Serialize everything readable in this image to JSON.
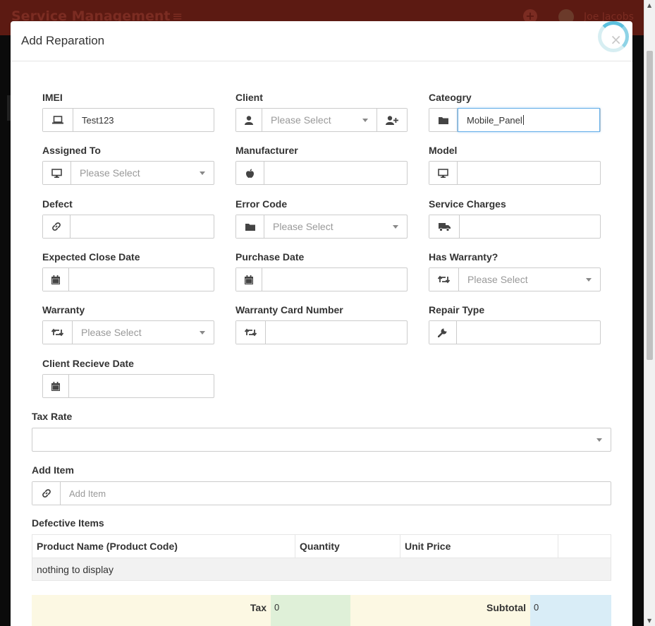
{
  "app": {
    "title": "Service Management",
    "menu_icon": "hamburger-icon",
    "add_icon": "plus-circle-icon",
    "user_name": "Joe Jacobs"
  },
  "modal": {
    "title": "Add Reparation",
    "close": "×"
  },
  "fields": {
    "imei": {
      "label": "IMEI",
      "value": "Test123",
      "icon": "laptop-icon"
    },
    "client": {
      "label": "Client",
      "placeholder": "Please Select",
      "icon": "user-icon",
      "action_icon": "user-plus-icon"
    },
    "category": {
      "label": "Cateogry",
      "value": "Mobile_Panel",
      "icon": "folder-icon"
    },
    "assigned_to": {
      "label": "Assigned To",
      "placeholder": "Please Select",
      "icon": "desktop-icon"
    },
    "manufacturer": {
      "label": "Manufacturer",
      "value": "",
      "icon": "apple-icon"
    },
    "model": {
      "label": "Model",
      "value": "",
      "icon": "desktop-icon"
    },
    "defect": {
      "label": "Defect",
      "value": "",
      "icon": "link-icon"
    },
    "error_code": {
      "label": "Error Code",
      "placeholder": "Please Select",
      "icon": "folder-icon"
    },
    "service_charges": {
      "label": "Service Charges",
      "value": "",
      "icon": "truck-icon"
    },
    "expected_close_date": {
      "label": "Expected Close Date",
      "value": "",
      "icon": "calendar-icon"
    },
    "purchase_date": {
      "label": "Purchase Date",
      "value": "",
      "icon": "calendar-icon"
    },
    "has_warranty": {
      "label": "Has Warranty?",
      "placeholder": "Please Select",
      "icon": "retweet-icon"
    },
    "warranty": {
      "label": "Warranty",
      "placeholder": "Please Select",
      "icon": "retweet-icon"
    },
    "warranty_card_number": {
      "label": "Warranty Card Number",
      "value": "",
      "icon": "retweet-icon"
    },
    "repair_type": {
      "label": "Repair Type",
      "value": "",
      "icon": "wrench-icon"
    },
    "client_receive_date": {
      "label": "Client Recieve Date",
      "value": "",
      "icon": "calendar-icon"
    }
  },
  "tax_rate": {
    "label": "Tax Rate",
    "value": ""
  },
  "add_item": {
    "label": "Add Item",
    "placeholder": "Add Item",
    "icon": "link-icon"
  },
  "defective_items": {
    "label": "Defective Items",
    "columns": [
      "Product Name (Product Code)",
      "Quantity",
      "Unit Price",
      ""
    ],
    "empty_text": "nothing to display"
  },
  "totals": {
    "tax_label": "Tax",
    "tax_value": "0",
    "subtotal_label": "Subtotal",
    "subtotal_value": "0"
  }
}
